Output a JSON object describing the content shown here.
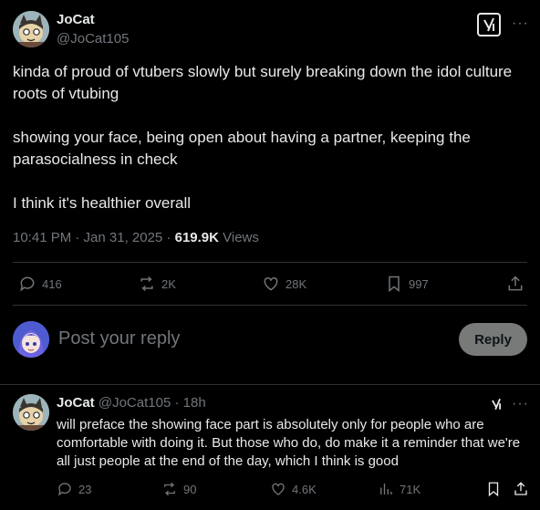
{
  "tweet": {
    "author_name": "JoCat",
    "author_handle": "@JoCat105",
    "text": "kinda of proud of vtubers slowly but surely breaking down the idol culture roots of vtubing\n\nshowing your face, being open about having a partner, keeping the parasocialness in check\n\nI think it's healthier overall",
    "time": "10:41 PM · Jan 31, 2025 · ",
    "views_count": "619.9K",
    "views_label": " Views",
    "replies": "416",
    "reposts": "2K",
    "likes": "28K",
    "bookmarks": "997"
  },
  "composer": {
    "placeholder": "Post your reply",
    "reply_label": "Reply"
  },
  "reply": {
    "author_name": "JoCat",
    "author_handle": "@JoCat105",
    "time": "· 18h",
    "text": "will preface the showing face part is absolutely only for people who are comfortable with doing it. But those who do, do make it a reminder that we're all just people at the end of the day, which I think is good",
    "replies": "23",
    "reposts": "90",
    "likes": "4.6K",
    "views": "71K"
  },
  "more_glyph": "···",
  "colors": {
    "bg": "#000000",
    "text": "#e7e9ea",
    "muted": "#71767b",
    "divider": "#2f3336"
  }
}
